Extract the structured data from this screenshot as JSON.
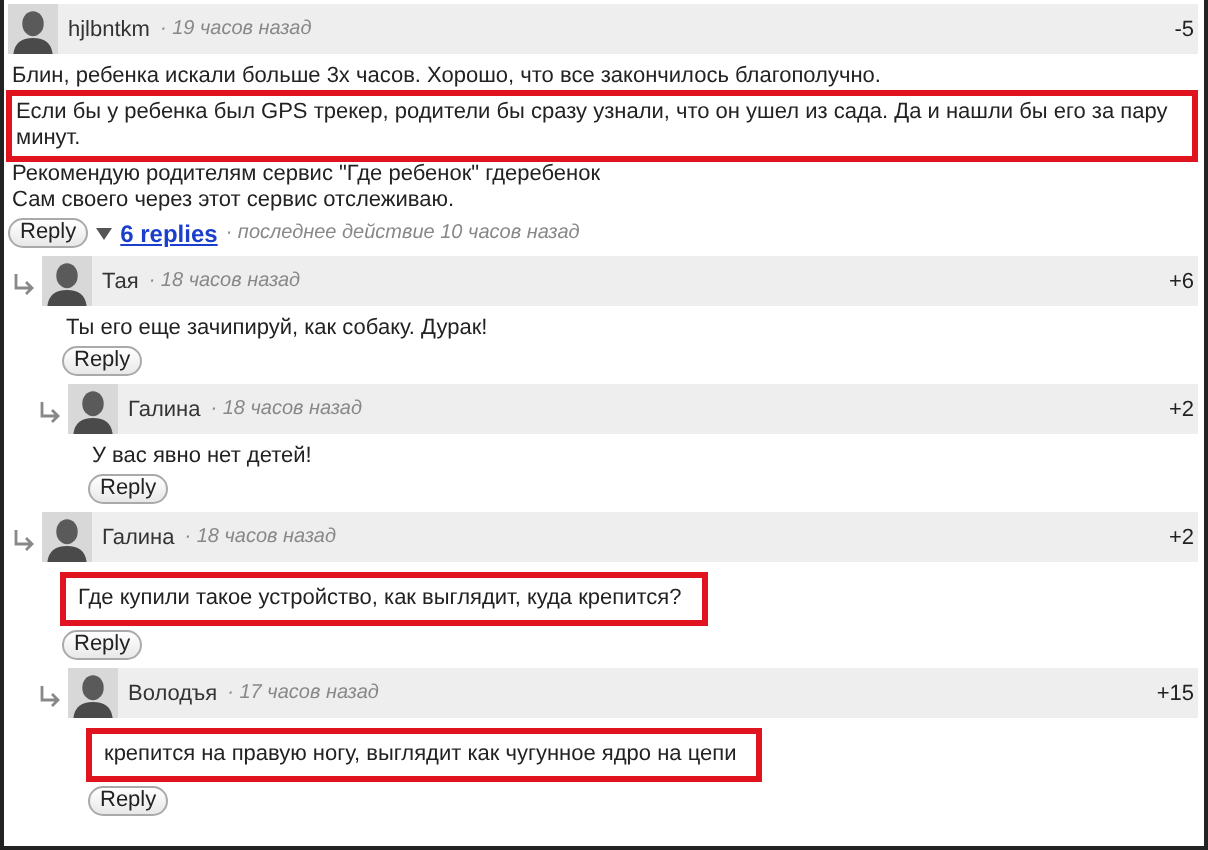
{
  "comments": [
    {
      "author": "hjlbntkm",
      "time": "· 19 часов назад",
      "score": "-5",
      "lines": [
        {
          "text": "Блин, ребенка искали больше 3х часов. Хорошо, что все закончилось благополучно.",
          "highlighted": false
        },
        {
          "text": "Если бы у ребенка был GPS трекер, родители бы сразу узнали, что он ушел из сада. Да и нашли бы его за пару минут.",
          "highlighted": true
        },
        {
          "text": "Рекомендую родителям сервис \"Где ребенок\" гдеребенок",
          "highlighted": false
        },
        {
          "text": "Сам своего через этот сервис отслеживаю.",
          "highlighted": false
        }
      ],
      "reply": "Reply",
      "replies_link": "6 replies",
      "activity": "· последнее действие 10 часов назад",
      "children": [
        {
          "author": "Тая",
          "time": "· 18 часов назад",
          "score": "+6",
          "lines": [
            {
              "text": "Ты его еще зачипируй, как собаку. Дурак!",
              "highlighted": false
            }
          ],
          "reply": "Reply",
          "children": [
            {
              "author": "Галина",
              "time": "· 18 часов назад",
              "score": "+2",
              "lines": [
                {
                  "text": "У вас явно нет детей!",
                  "highlighted": false
                }
              ],
              "reply": "Reply"
            }
          ]
        },
        {
          "author": "Галина",
          "time": "· 18 часов назад",
          "score": "+2",
          "lines": [
            {
              "text": "Где купили такое устройство, как выглядит, куда крепится?",
              "highlighted": true
            }
          ],
          "reply": "Reply",
          "children": [
            {
              "author": "Володъя",
              "time": "· 17 часов назад",
              "score": "+15",
              "lines": [
                {
                  "text": "крепится на правую ногу, выглядит как чугунное ядро на цепи",
                  "highlighted": true
                }
              ],
              "reply": "Reply"
            }
          ]
        }
      ]
    }
  ]
}
